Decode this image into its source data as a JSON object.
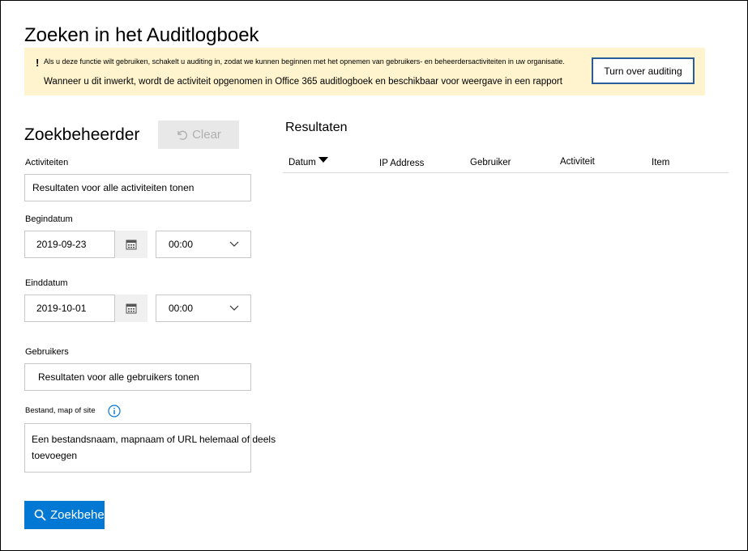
{
  "page": {
    "title": "Zoeken in het Auditlogboek"
  },
  "banner": {
    "line1": "Als u deze functie wilt gebruiken, schakelt u auditing in, zodat we kunnen beginnen met het opnemen van gebruikers- en beheerdersactiviteiten in uw organisatie.",
    "line2": "Wanneer u dit inwerkt, wordt de activiteit opgenomen in Office 365 auditlogboek en beschikbaar voor weergave in een rapport",
    "button_label": "Turn over auditing"
  },
  "search_panel": {
    "title": "Zoekbeheerder",
    "clear_label": "Clear",
    "activities": {
      "label": "Activiteiten",
      "value": "Resultaten voor alle activiteiten tonen"
    },
    "start_date": {
      "label": "Begindatum",
      "date": "2019-09-23",
      "time": "00:00"
    },
    "end_date": {
      "label": "Einddatum",
      "date": "2019-10-01",
      "time": "00:00"
    },
    "users": {
      "label": "Gebruikers",
      "value": "Resultaten voor alle gebruikers tonen"
    },
    "file": {
      "label": "Bestand, map of site",
      "placeholder_line1": "Een bestandsnaam, mapnaam of URL helemaal of deels",
      "placeholder_line2": "toevoegen"
    },
    "search_button_label": "Zoekbeheerder"
  },
  "results": {
    "title": "Resultaten",
    "columns": [
      "Datum",
      "IP Address",
      "Gebruiker",
      "Activiteit",
      "Item"
    ]
  },
  "icons": [
    "warning-icon",
    "undo-icon",
    "calendar-icon",
    "chevron-down-icon",
    "info-icon",
    "search-icon",
    "sort-desc-icon"
  ],
  "colors": {
    "banner_bg": "#fff4ce",
    "primary": "#0078d4",
    "banner_button_border": "#2b5c9a"
  }
}
